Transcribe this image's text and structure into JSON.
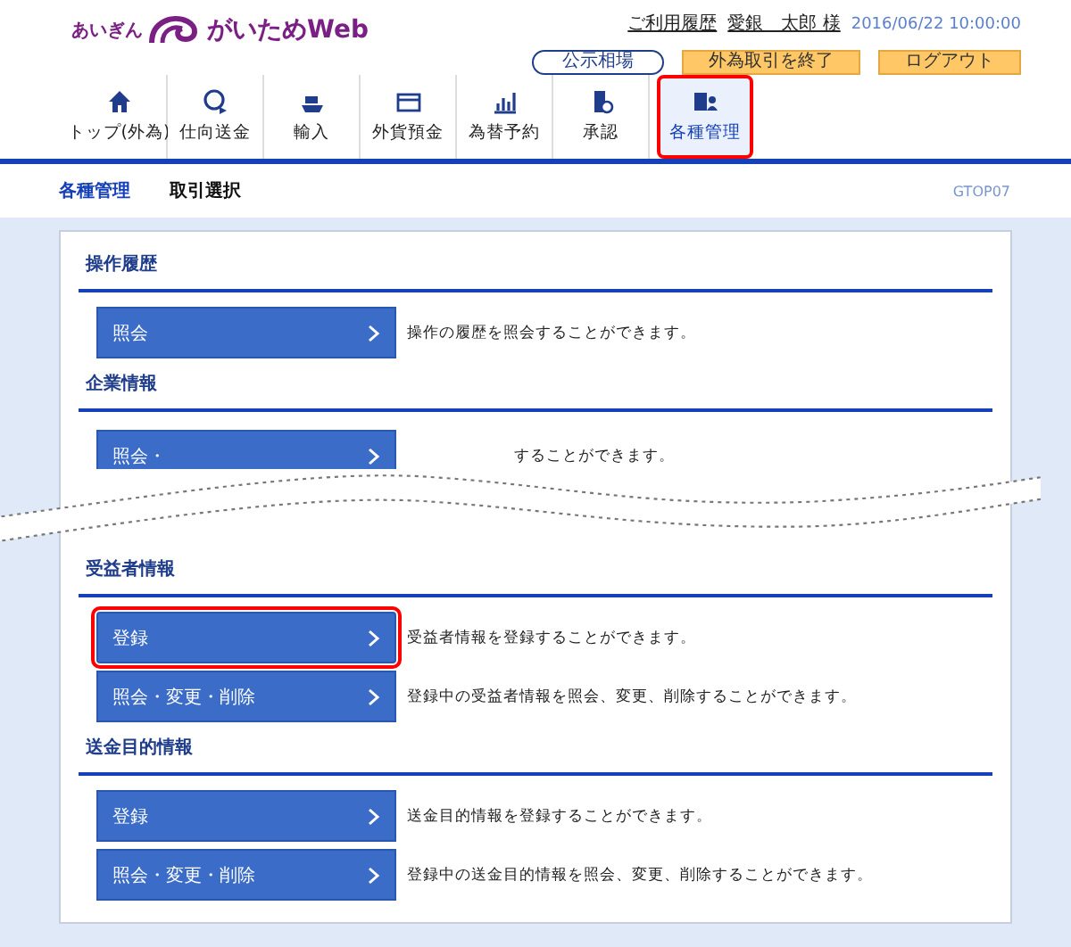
{
  "header": {
    "bank_name": "あいぎん",
    "logo_text": "がいためWeb",
    "history_link": "ご利用履歴",
    "user_name": "愛銀　太郎 様",
    "datetime": "2016/06/22 10:00:00",
    "buttons": [
      {
        "label": "公示相場",
        "kind": "outline"
      },
      {
        "label": "外為取引を終了",
        "kind": "action"
      },
      {
        "label": "ログアウト",
        "kind": "action"
      }
    ]
  },
  "nav_tabs": [
    {
      "label": "トップ(外為)",
      "selected": false,
      "highlighted": false
    },
    {
      "label": "仕向送金",
      "selected": false,
      "highlighted": false
    },
    {
      "label": "輸入",
      "selected": false,
      "highlighted": false
    },
    {
      "label": "外貨預金",
      "selected": false,
      "highlighted": false
    },
    {
      "label": "為替予約",
      "selected": false,
      "highlighted": false
    },
    {
      "label": "承認",
      "selected": false,
      "highlighted": false
    },
    {
      "label": "各種管理",
      "selected": true,
      "highlighted": true
    }
  ],
  "breadcrumb": {
    "title": "各種管理",
    "subtitle": "取引選択",
    "screen_id": "GTOP07"
  },
  "sections": [
    {
      "title": "操作履歴",
      "rows": [
        {
          "label": "照会",
          "description": "操作の履歴を照会することができます。",
          "highlighted": false
        }
      ]
    },
    {
      "title": "企業情報",
      "cut": true,
      "rows": [
        {
          "label": "照会・",
          "description": "することができます。",
          "highlighted": false
        }
      ]
    },
    {
      "title": "受益者情報",
      "rows": [
        {
          "label": "登録",
          "description": "受益者情報を登録することができます。",
          "highlighted": true
        },
        {
          "label": "照会・変更・削除",
          "description": "登録中の受益者情報を照会、変更、削除することができます。",
          "highlighted": false
        }
      ]
    },
    {
      "title": "送金目的情報",
      "rows": [
        {
          "label": "登録",
          "description": "送金目的情報を登録することができます。",
          "highlighted": false
        },
        {
          "label": "照会・変更・削除",
          "description": "登録中の送金目的情報を照会、変更、削除することができます。",
          "highlighted": false
        }
      ]
    }
  ]
}
